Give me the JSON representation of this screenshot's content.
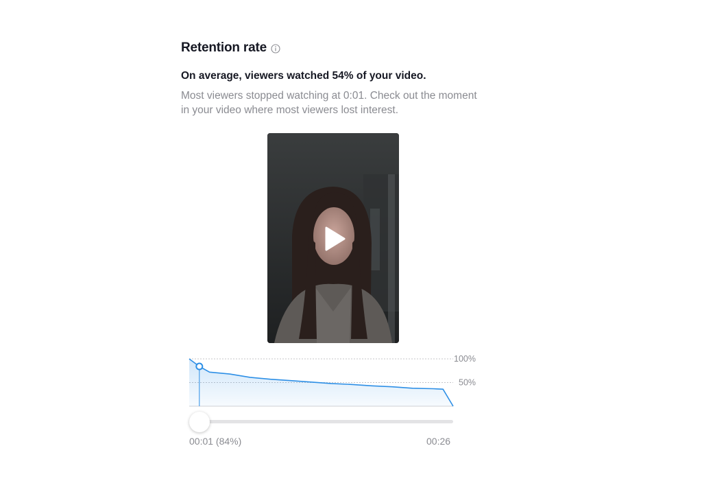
{
  "header": {
    "title": "Retention rate",
    "info_icon": "info-circle-icon"
  },
  "summary": {
    "headline": "On average, viewers watched 54% of your video.",
    "description": "Most viewers stopped watching at 0:01. Check out the moment in your video where most viewers lost interest."
  },
  "video": {
    "play_icon": "play-icon"
  },
  "colors": {
    "accent": "#2d8fe6",
    "text_primary": "#161823",
    "text_secondary": "#8a8b91"
  },
  "chart_data": {
    "type": "area",
    "x_unit": "seconds",
    "x": [
      0,
      1,
      2,
      4,
      6,
      8,
      10,
      12,
      14,
      16,
      18,
      20,
      22,
      24,
      25,
      26
    ],
    "y": [
      100,
      84,
      72,
      68,
      61,
      57,
      54,
      51,
      48,
      46,
      43,
      41,
      38,
      37,
      36,
      0
    ],
    "ylim": [
      0,
      100
    ],
    "ytick_labels": [
      "100%",
      "50%"
    ],
    "ytick_values": [
      100,
      50
    ],
    "selected_point": {
      "x": 1,
      "y": 84
    },
    "grid": true
  },
  "playback": {
    "position_fraction": 0,
    "current_label": "00:01 (84%)",
    "duration_label": "00:26"
  }
}
